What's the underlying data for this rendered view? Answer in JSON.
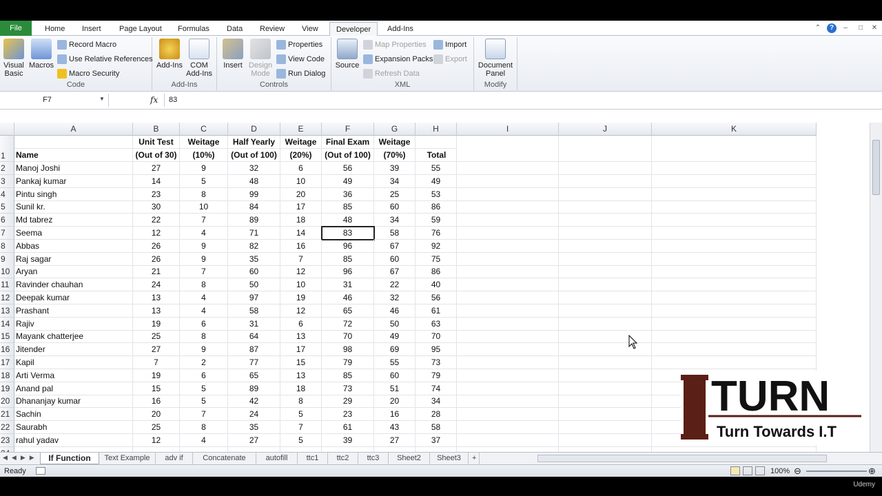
{
  "tabs": {
    "file": "File",
    "home": "Home",
    "insert": "Insert",
    "page_layout": "Page Layout",
    "formulas": "Formulas",
    "data": "Data",
    "review": "Review",
    "view": "View",
    "developer": "Developer",
    "addins": "Add-Ins"
  },
  "ribbon": {
    "code": {
      "label": "Code",
      "visual_basic": "Visual Basic",
      "macros": "Macros",
      "record_macro": "Record Macro",
      "relative_refs": "Use Relative References",
      "macro_security": "Macro Security"
    },
    "addins": {
      "label": "Add-Ins",
      "addins": "Add-Ins",
      "com_addins": "COM Add-Ins"
    },
    "controls": {
      "label": "Controls",
      "insert": "Insert",
      "design_mode": "Design Mode",
      "properties": "Properties",
      "view_code": "View Code",
      "run_dialog": "Run Dialog"
    },
    "xml": {
      "label": "XML",
      "source": "Source",
      "map_properties": "Map Properties",
      "expansion_packs": "Expansion Packs",
      "refresh_data": "Refresh Data",
      "import": "Import",
      "export": "Export"
    },
    "modify": {
      "label": "Modify",
      "document_panel": "Document Panel"
    }
  },
  "formula_bar": {
    "name_box": "F7",
    "fx": "fx",
    "value": "83"
  },
  "columns": [
    "A",
    "B",
    "C",
    "D",
    "E",
    "F",
    "G",
    "H",
    "I",
    "J",
    "K"
  ],
  "headers": {
    "name": "Name",
    "b1": "Unit Test",
    "b2": "(Out of 30)",
    "c1": "Weitage",
    "c2": "(10%)",
    "d1": "Half Yearly",
    "d2": "(Out of 100)",
    "e1": "Weitage",
    "e2": "(20%)",
    "f1": "Final Exam",
    "f2": "(Out of 100)",
    "g1": "Weitage",
    "g2": "(70%)",
    "h": "Total"
  },
  "rows": [
    [
      "Manoj Joshi",
      "27",
      "9",
      "32",
      "6",
      "56",
      "39",
      "55"
    ],
    [
      "Pankaj kumar",
      "14",
      "5",
      "48",
      "10",
      "49",
      "34",
      "49"
    ],
    [
      "Pintu singh",
      "23",
      "8",
      "99",
      "20",
      "36",
      "25",
      "53"
    ],
    [
      "Sunil kr.",
      "30",
      "10",
      "84",
      "17",
      "85",
      "60",
      "86"
    ],
    [
      "Md tabrez",
      "22",
      "7",
      "89",
      "18",
      "48",
      "34",
      "59"
    ],
    [
      "Seema",
      "12",
      "4",
      "71",
      "14",
      "83",
      "58",
      "76"
    ],
    [
      "Abbas",
      "26",
      "9",
      "82",
      "16",
      "96",
      "67",
      "92"
    ],
    [
      "Raj sagar",
      "26",
      "9",
      "35",
      "7",
      "85",
      "60",
      "75"
    ],
    [
      "Aryan",
      "21",
      "7",
      "60",
      "12",
      "96",
      "67",
      "86"
    ],
    [
      "Ravinder chauhan",
      "24",
      "8",
      "50",
      "10",
      "31",
      "22",
      "40"
    ],
    [
      "Deepak kumar",
      "13",
      "4",
      "97",
      "19",
      "46",
      "32",
      "56"
    ],
    [
      "Prashant",
      "13",
      "4",
      "58",
      "12",
      "65",
      "46",
      "61"
    ],
    [
      "Rajiv",
      "19",
      "6",
      "31",
      "6",
      "72",
      "50",
      "63"
    ],
    [
      "Mayank chatterjee",
      "25",
      "8",
      "64",
      "13",
      "70",
      "49",
      "70"
    ],
    [
      "Jitender",
      "27",
      "9",
      "87",
      "17",
      "98",
      "69",
      "95"
    ],
    [
      "Kapil",
      "7",
      "2",
      "77",
      "15",
      "79",
      "55",
      "73"
    ],
    [
      "Arti Verma",
      "19",
      "6",
      "65",
      "13",
      "85",
      "60",
      "79"
    ],
    [
      "Anand pal",
      "15",
      "5",
      "89",
      "18",
      "73",
      "51",
      "74"
    ],
    [
      "Dhananjay kumar",
      "16",
      "5",
      "42",
      "8",
      "29",
      "20",
      "34"
    ],
    [
      "Sachin",
      "20",
      "7",
      "24",
      "5",
      "23",
      "16",
      "28"
    ],
    [
      "Saurabh",
      "25",
      "8",
      "35",
      "7",
      "61",
      "43",
      "58"
    ],
    [
      "rahul yadav",
      "12",
      "4",
      "27",
      "5",
      "39",
      "27",
      "37"
    ]
  ],
  "sheets": [
    "If Function",
    "Text Example",
    "adv if",
    "Concatenate",
    "autofill",
    "ttc1",
    "ttc2",
    "ttc3",
    "Sheet2",
    "Sheet3"
  ],
  "status": {
    "ready": "Ready",
    "zoom": "100%"
  },
  "logo": {
    "big": "I TURN",
    "small": "Turn Towards I.T"
  },
  "watermark": "Udemy"
}
